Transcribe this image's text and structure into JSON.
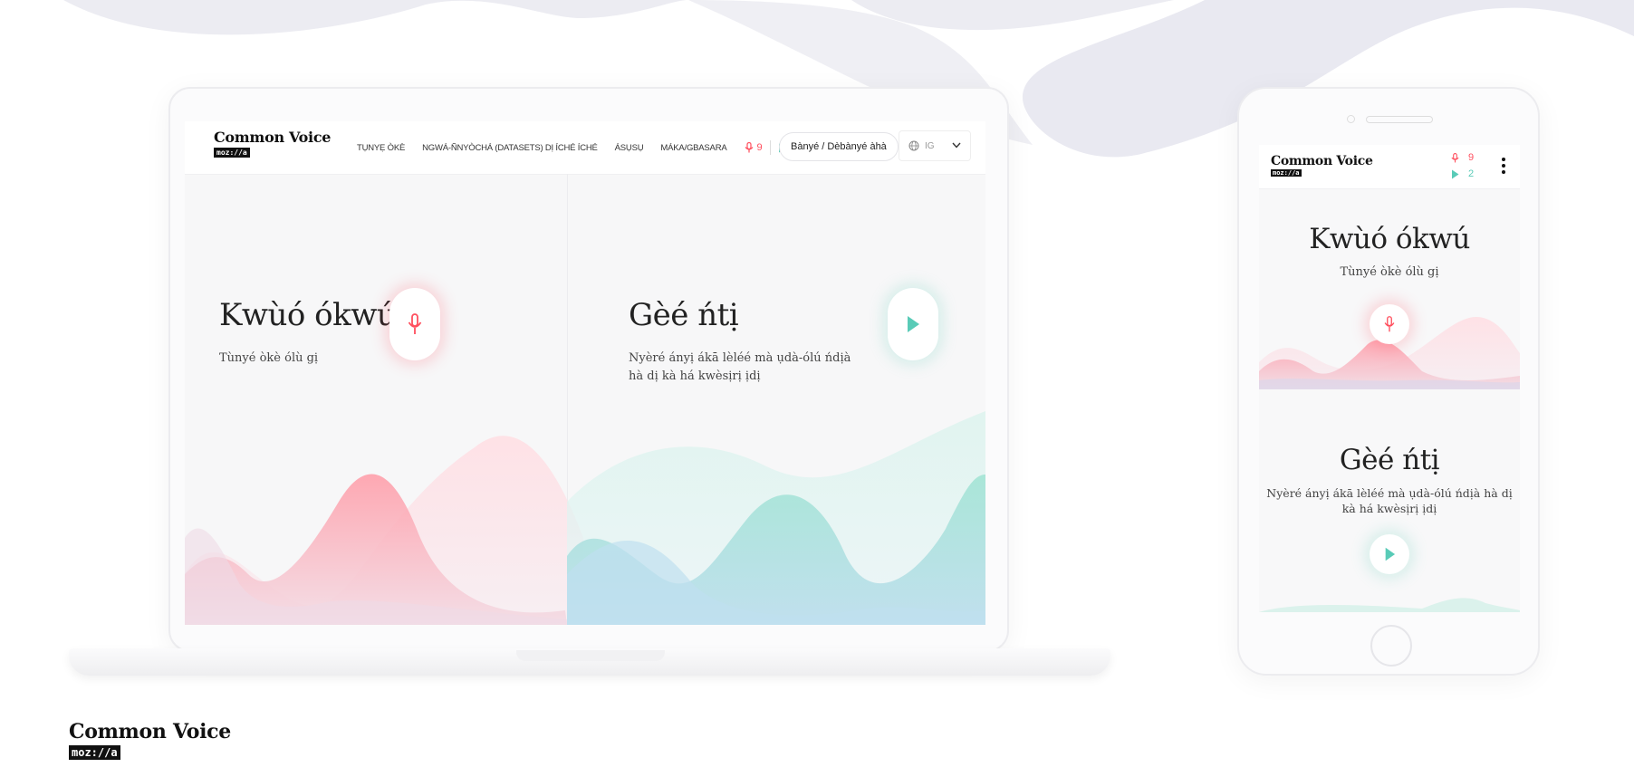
{
  "brand": {
    "name": "Common Voice",
    "sub": "moz://a"
  },
  "nav": {
    "links": [
      "TỤNYẸ ÒKÈ",
      "NGWÁ-ÑNYÒCHÁ (DATASETS) DỊ ÍCHÉ ÍCHÉ",
      "ÁSỤSỤ",
      "MÁKA/GBASARA"
    ],
    "recordings_count": "9",
    "clips_count": "2",
    "login_label": "Bànyé / Dèbànyé àhà",
    "language_code": "IG"
  },
  "speak": {
    "title": "Kwùó ókwú",
    "subtitle": "Tùnyé òkè ólù gị"
  },
  "listen": {
    "title": "Gèé ńtị",
    "subtitle": "Nyèré ányị ákā lèléé mà ụdà-ólú ńdịà hà dị kà há kwèsịrị ịdị"
  },
  "colors": {
    "accent_red": "#ff4f5e",
    "accent_green": "#59cbb7"
  },
  "icons": [
    "microphone-icon",
    "play-icon",
    "globe-icon",
    "chevron-down-icon",
    "kebab-menu-icon"
  ]
}
